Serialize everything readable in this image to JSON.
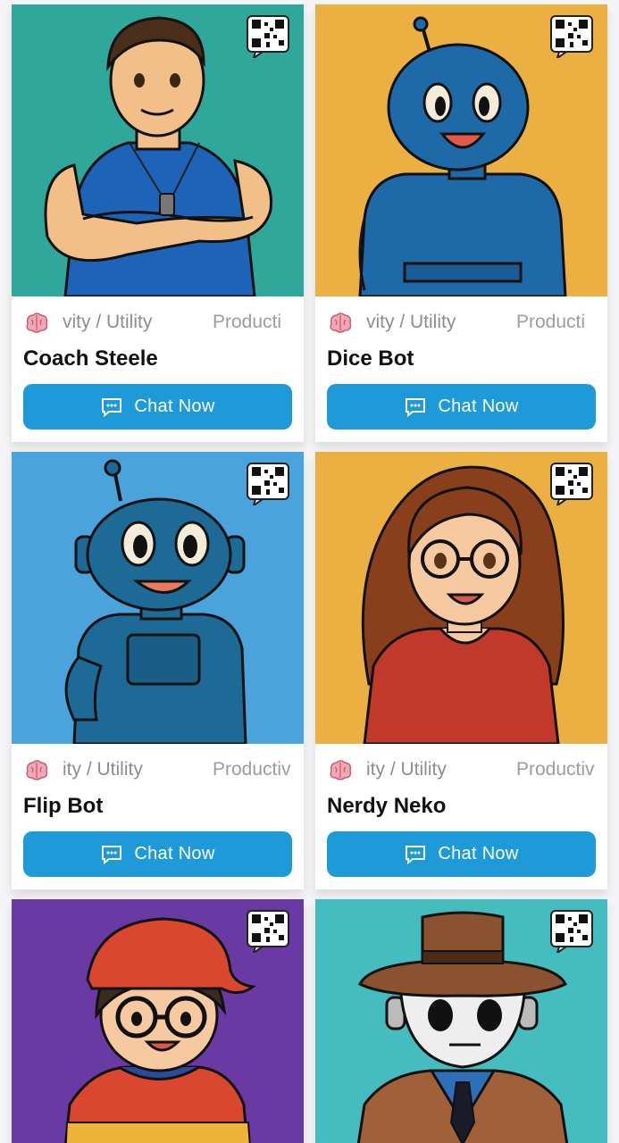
{
  "cards": [
    {
      "name": "Coach Steele",
      "tag1": "vity / Utility",
      "tag2": "Producti",
      "chat_label": "Chat Now",
      "bg": "#2fa79a",
      "art": "coach-steele-illustration"
    },
    {
      "name": "Dice Bot",
      "tag1": "vity / Utility",
      "tag2": "Producti",
      "chat_label": "Chat Now",
      "bg": "#ecb042",
      "art": "dice-bot-illustration"
    },
    {
      "name": "Flip Bot",
      "tag1": "ity / Utility",
      "tag2": "Productiv",
      "chat_label": "Chat Now",
      "bg": "#4aa3db",
      "art": "flip-bot-illustration"
    },
    {
      "name": "Nerdy Neko",
      "tag1": "ity / Utility",
      "tag2": "Productiv",
      "chat_label": "Chat Now",
      "bg": "#ecb042",
      "art": "nerdy-neko-illustration"
    },
    {
      "name": "",
      "bg": "#6a3aa4",
      "art": "cap-boy-illustration"
    },
    {
      "name": "",
      "bg": "#45bcbd",
      "art": "detective-robot-illustration"
    }
  ],
  "icons": {
    "qr": "qr-code-icon",
    "brain": "brain-icon",
    "chat": "chat-bubble-icon"
  },
  "colors": {
    "button": "#1f9ad8",
    "background": "#f4f4f6"
  }
}
